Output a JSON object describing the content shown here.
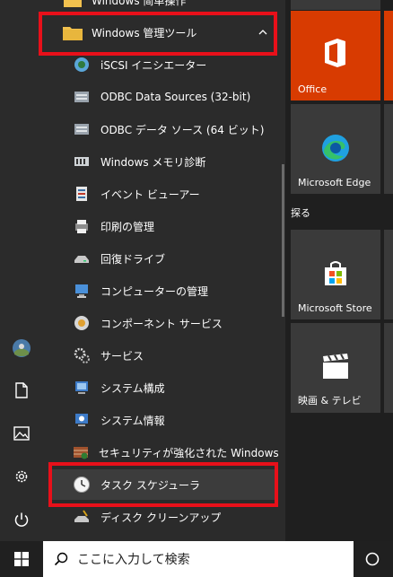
{
  "app_list": {
    "top_partial_label": "Windows 简单操作",
    "folder_label": "Windows 管理ツール",
    "items": [
      {
        "label": "iSCSI イニシエーター",
        "icon": "iscsi-icon"
      },
      {
        "label": "ODBC Data Sources (32-bit)",
        "icon": "odbc-icon"
      },
      {
        "label": "ODBC データ ソース (64 ビット)",
        "icon": "odbc-icon"
      },
      {
        "label": "Windows メモリ診断",
        "icon": "memory-diagnostic-icon"
      },
      {
        "label": "イベント ビューアー",
        "icon": "event-viewer-icon"
      },
      {
        "label": "印刷の管理",
        "icon": "print-management-icon"
      },
      {
        "label": "回復ドライブ",
        "icon": "recovery-drive-icon"
      },
      {
        "label": "コンピューターの管理",
        "icon": "computer-management-icon"
      },
      {
        "label": "コンポーネント サービス",
        "icon": "component-services-icon"
      },
      {
        "label": "サービス",
        "icon": "services-icon"
      },
      {
        "label": "システム構成",
        "icon": "system-configuration-icon"
      },
      {
        "label": "システム情報",
        "icon": "system-information-icon"
      },
      {
        "label": "セキュリティが強化された Windows Def...",
        "icon": "firewall-icon"
      },
      {
        "label": "タスク スケジューラ",
        "icon": "task-scheduler-icon"
      },
      {
        "label": "ディスク クリーンアップ",
        "icon": "disk-cleanup-icon"
      }
    ]
  },
  "tiles": {
    "section_label": "探る",
    "office": {
      "label": "Office",
      "color": "#d83b01"
    },
    "edge": {
      "label": "Microsoft Edge",
      "color": "#3a3a3a"
    },
    "store": {
      "label": "Microsoft Store",
      "color": "#3a3a3a"
    },
    "movies": {
      "label": "映画 & テレビ",
      "color": "#3a3a3a"
    }
  },
  "taskbar": {
    "search_placeholder": "ここに入力して検索"
  },
  "colors": {
    "highlight": "#e8101a",
    "accent": "#0078d7"
  }
}
